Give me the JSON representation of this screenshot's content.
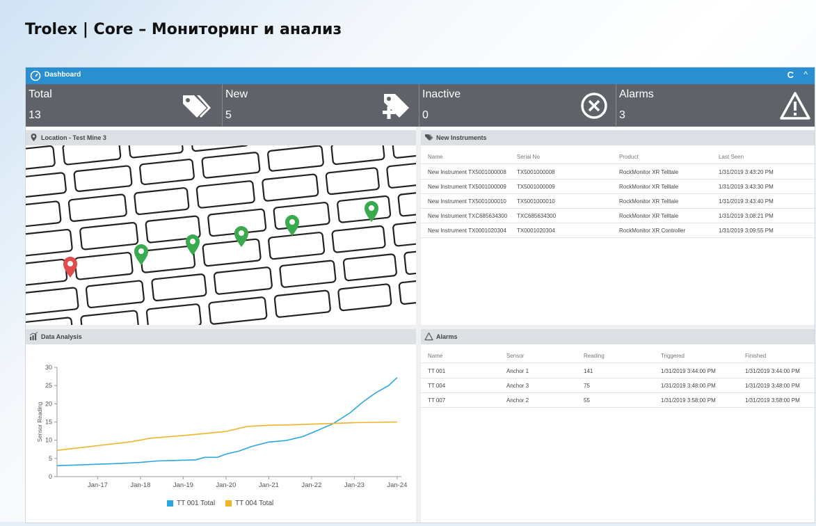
{
  "slide_title": "Trolex  | Core – Мониторинг и анализ",
  "dashboard": {
    "title": "Dashboard",
    "refresh_icon": "C",
    "collapse_icon": "^"
  },
  "stats": [
    {
      "label": "Total",
      "value": "13",
      "icon": "tags-icon"
    },
    {
      "label": "New",
      "value": "5",
      "icon": "tag-plus-icon"
    },
    {
      "label": "Inactive",
      "value": "0",
      "icon": "circle-x-icon"
    },
    {
      "label": "Alarms",
      "value": "3",
      "icon": "warning-icon"
    }
  ],
  "location": {
    "title": "Location - Test Mine 3"
  },
  "new_instruments": {
    "title": "New Instruments",
    "columns": [
      "Name",
      "Serial No",
      "Product",
      "Last Seen"
    ],
    "rows": [
      [
        "New Instrument TX5001000008",
        "TX5001000008",
        "RockMonitor XR Telltale",
        "1/31/2019 3:43:20 PM"
      ],
      [
        "New Instrument TX5001000009",
        "TX5001000009",
        "RockMonitor XR Telltale",
        "1/31/2019 3:43:30 PM"
      ],
      [
        "New Instrument TX5001000010",
        "TX5001000010",
        "RockMonitor XR Telltale",
        "1/31/2019 3:43:40 PM"
      ],
      [
        "New Instrument TXC685634300",
        "TXC685634300",
        "RockMonitor XR Telltale",
        "1/31/2019 3:08:21 PM"
      ],
      [
        "New Instrument TX0001020304",
        "TX0001020304",
        "RockMonitor XR Controller",
        "1/31/2019 3:09:55 PM"
      ]
    ]
  },
  "alarms": {
    "title": "Alarms",
    "columns": [
      "Name",
      "Sensor",
      "Reading",
      "Triggered",
      "Finished"
    ],
    "rows": [
      [
        "TT 001",
        "Anchor 1",
        "141",
        "1/31/2019 3:44:00 PM",
        "1/31/2019 3:44:00 PM"
      ],
      [
        "TT 004",
        "Anchor 3",
        "75",
        "1/31/2019 3:48:00 PM",
        "1/31/2019 3:48:00 PM"
      ],
      [
        "TT 007",
        "Anchor 2",
        "55",
        "1/31/2019 3:58:00 PM",
        "1/31/2019 3:58:00 PM"
      ]
    ]
  },
  "data_analysis": {
    "title": "Data Analysis"
  },
  "chart_data": {
    "type": "line",
    "xlabel": "",
    "ylabel": "Sensor Reading",
    "ylim": [
      0,
      30
    ],
    "yticks": [
      0,
      5,
      10,
      15,
      20,
      25,
      30
    ],
    "xticks": [
      "Jan-17",
      "Jan-18",
      "Jan-19",
      "Jan-20",
      "Jan-21",
      "Jan-22",
      "Jan-23",
      "Jan-24"
    ],
    "xticks_pos": [
      1,
      2,
      3,
      4,
      5,
      6,
      7,
      8
    ],
    "xlim": [
      0.05,
      8.1
    ],
    "grid": false,
    "legend": "bottom",
    "series": [
      {
        "name": "TT 001 Total",
        "color": "#2aa7e0",
        "x": [
          0.05,
          1.0,
          1.5,
          2.0,
          2.4,
          3.0,
          3.3,
          3.5,
          3.8,
          4.0,
          4.3,
          4.6,
          5.0,
          5.4,
          5.8,
          6.1,
          6.5,
          6.9,
          7.2,
          7.5,
          7.8,
          8.0
        ],
        "y": [
          3.0,
          3.4,
          3.6,
          3.9,
          4.3,
          4.5,
          4.6,
          5.3,
          5.3,
          6.2,
          7.0,
          8.3,
          9.5,
          9.9,
          11.0,
          12.5,
          14.5,
          17.5,
          20.5,
          23.0,
          25.0,
          27.2
        ]
      },
      {
        "name": "TT 004 Total",
        "color": "#f0b429",
        "x": [
          0.05,
          1.0,
          1.8,
          2.2,
          3.0,
          3.5,
          4.0,
          4.5,
          5.0,
          5.5,
          6.0,
          6.5,
          7.0,
          7.5,
          8.0
        ],
        "y": [
          7.2,
          8.5,
          9.6,
          10.5,
          11.3,
          11.8,
          12.4,
          13.8,
          14.1,
          14.2,
          14.4,
          14.6,
          14.8,
          14.9,
          15.0
        ]
      }
    ]
  }
}
